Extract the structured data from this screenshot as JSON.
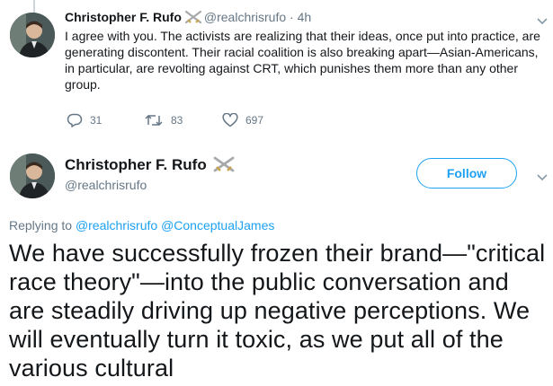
{
  "reply_tweet": {
    "author_name": "Christopher F. Rufo",
    "handle": "@realchrisrufo",
    "time": "4h",
    "separator": "·",
    "text": "I agree with you. The activists are realizing that their ideas, once put into practice, are generating discontent. Their racial coalition is also breaking apart—Asian-Americans, in particular, are revolting against CRT, which punishes them more than any other group.",
    "actions": {
      "reply_count": "31",
      "retweet_count": "83",
      "like_count": "697"
    }
  },
  "main_tweet": {
    "author_name": "Christopher F. Rufo",
    "handle": "@realchrisrufo",
    "follow_label": "Follow",
    "replying_prefix": "Replying to",
    "replying_to": [
      "@realchrisrufo",
      "@ConceptualJames"
    ],
    "text": "We have successfully frozen their brand—\"critical race theory\"—into the public conversation and are steadily driving up negative perceptions. We will eventually turn it toxic, as we put all of the various cultural"
  },
  "colors": {
    "accent": "#1da1f2",
    "muted": "#657786",
    "text": "#14171a"
  },
  "icons": {
    "name_badge": "crossed-swords-icon",
    "reply": "reply-icon",
    "retweet": "retweet-icon",
    "like": "heart-icon",
    "menu": "chevron-down-icon"
  }
}
